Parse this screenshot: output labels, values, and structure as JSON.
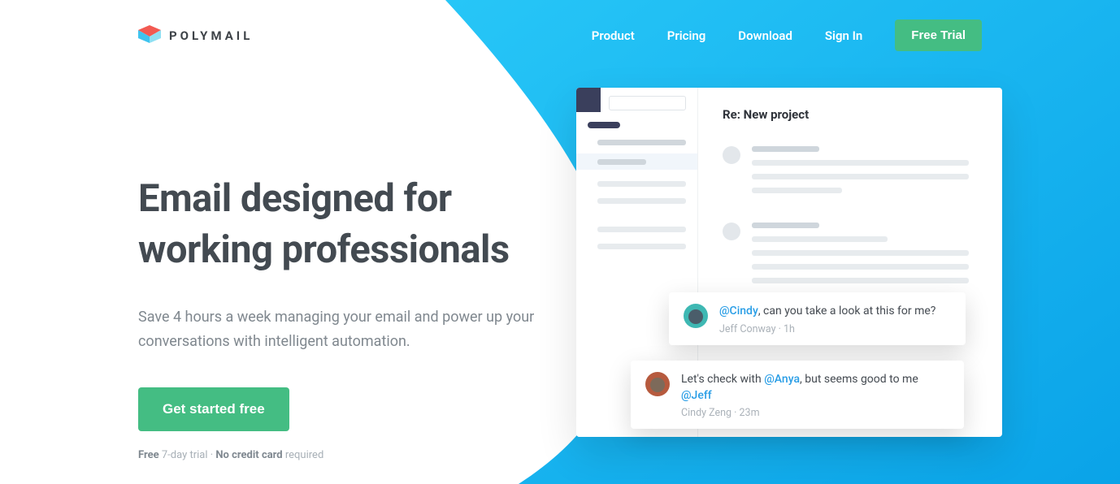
{
  "brand": "POLYMAIL",
  "nav": {
    "product": "Product",
    "pricing": "Pricing",
    "download": "Download",
    "signin": "Sign In",
    "trial": "Free Trial"
  },
  "hero": {
    "title_l1": "Email designed for",
    "title_l2": "working professionals",
    "subtitle": "Save 4 hours a week managing your email and power up your conversations with intelligent automation.",
    "cta": "Get started free",
    "note_free": "Free",
    "note_trial": " 7-day trial · ",
    "note_nocc": "No credit card",
    "note_req": " required"
  },
  "preview": {
    "subject": "Re: New project"
  },
  "comments": [
    {
      "mention1": "@Cindy",
      "text_after1": ", can you take a look at this for me?",
      "meta": "Jeff Conway · 1h"
    },
    {
      "text_before": "Let's check with ",
      "mention1": "@Anya",
      "text_mid": ", but seems good to me ",
      "mention2": "@Jeff",
      "meta": "Cindy Zeng · 23m"
    }
  ]
}
